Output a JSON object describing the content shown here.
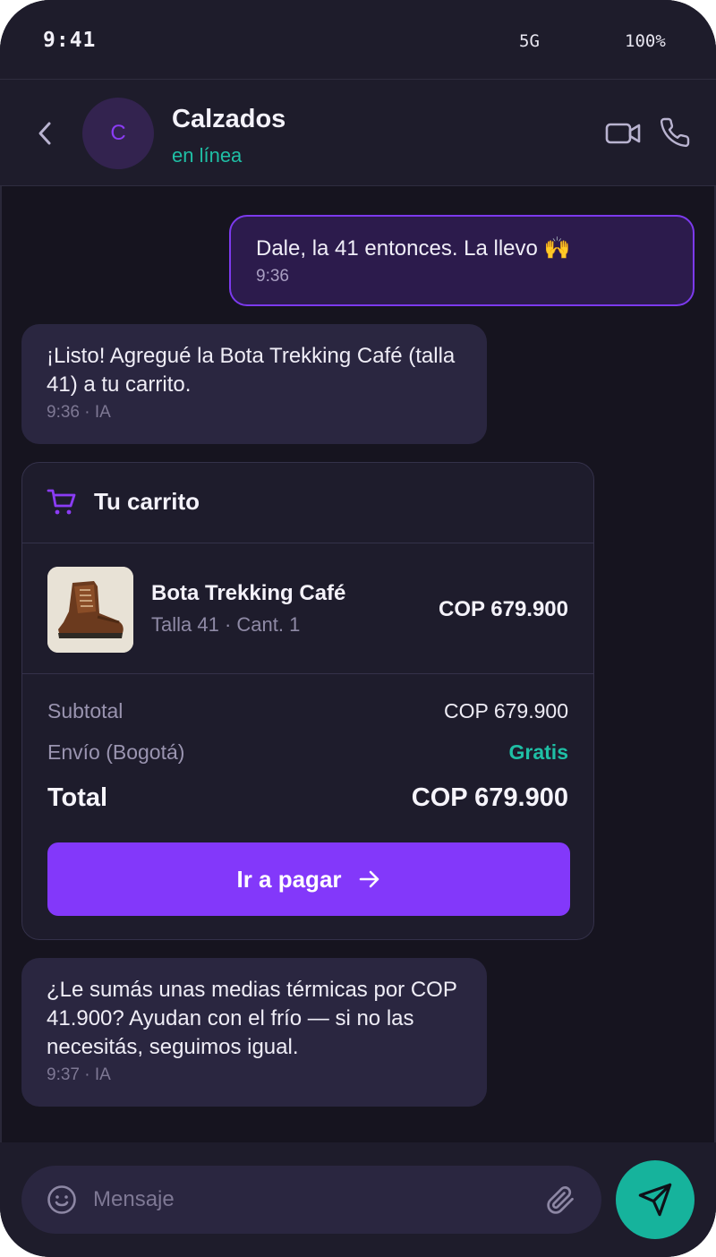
{
  "status_bar": {
    "time": "9:41",
    "network": "5G",
    "battery": "100%"
  },
  "header": {
    "avatar_initial": "C",
    "title": "Calzados",
    "subtitle": "en línea"
  },
  "messages": [
    {
      "direction": "outgoing",
      "text": "Dale, la 41 entonces. La llevo 🙌",
      "time": "9:36"
    },
    {
      "direction": "incoming",
      "text": "¡Listo! Agregué la Bota Trekking Café (talla 41) a tu carrito.",
      "time": "9:36 · IA"
    },
    {
      "direction": "incoming",
      "text": "¿Le sumás unas medias térmicas por COP 41.900? Ayudan con el frío — si no las necesitás, seguimos igual.",
      "time": "9:37 · IA"
    }
  ],
  "cart": {
    "title": "Tu carrito",
    "item": {
      "name": "Bota Trekking Café",
      "meta": "Talla 41 · Cant. 1",
      "price": "COP 679.900"
    },
    "subtotal_label": "Subtotal",
    "subtotal_value": "COP 679.900",
    "shipping_label": "Envío (Bogotá)",
    "shipping_value": "Gratis",
    "total_label": "Total",
    "total_value": "COP 679.900",
    "pay_label": "Ir a pagar"
  },
  "composer": {
    "placeholder": "Mensaje"
  },
  "colors": {
    "accent": "#8338fa",
    "teal": "#1fbfa5",
    "send": "#16b39c",
    "background": "#16141f"
  }
}
